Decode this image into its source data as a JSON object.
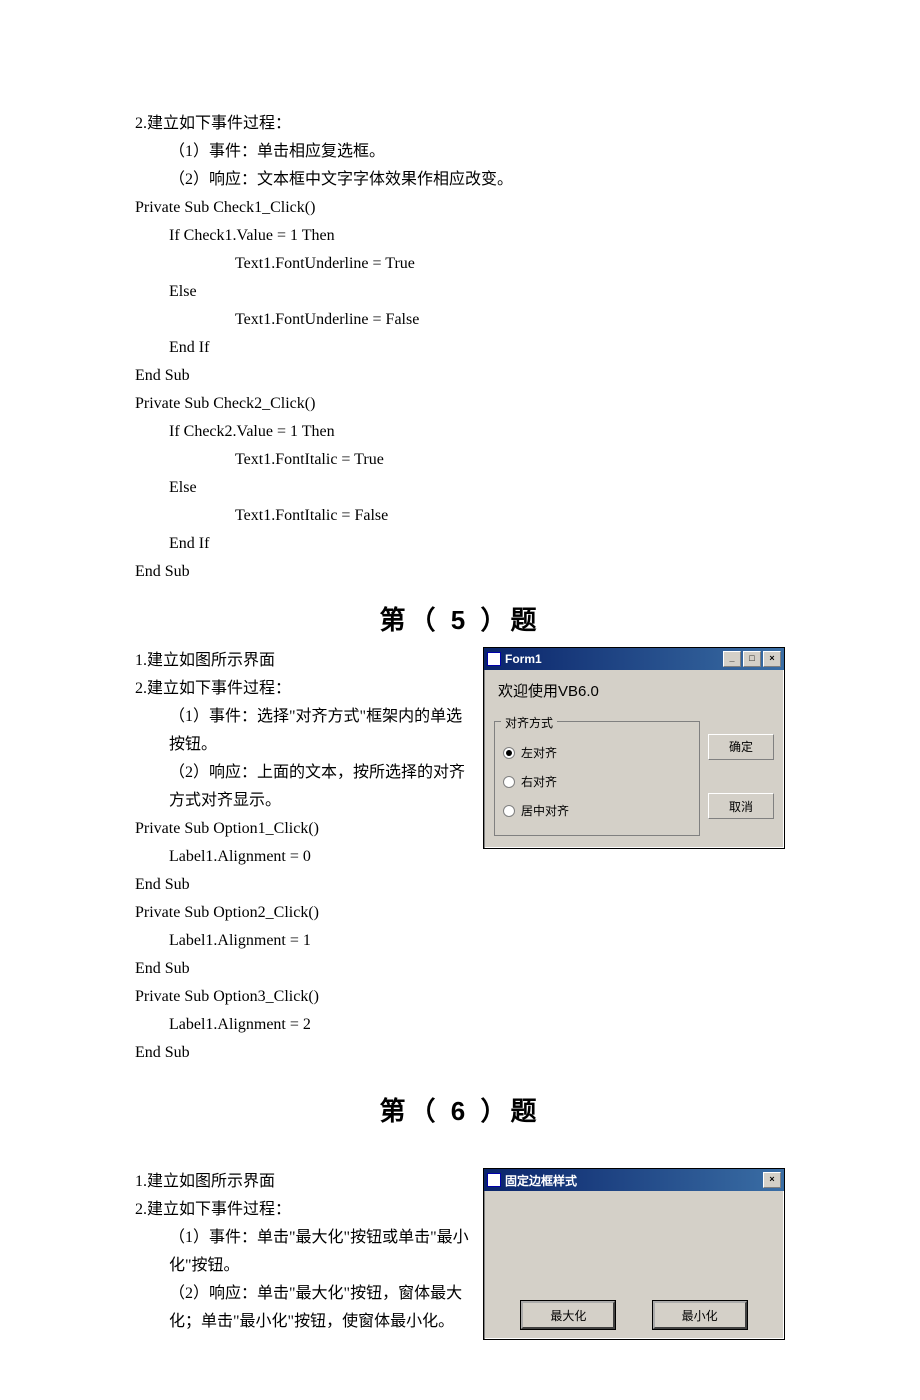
{
  "q4_tail": {
    "line1": "2.建立如下事件过程：",
    "line2": "（1）事件：单击相应复选框。",
    "line3": "（2）响应：文本框中文字字体效果作相应改变。",
    "code": [
      "Private Sub Check1_Click()",
      "    If Check1.Value = 1 Then",
      "            Text1.FontUnderline = True",
      "    Else",
      "            Text1.FontUnderline = False",
      "    End If",
      "End Sub",
      "Private Sub Check2_Click()",
      "    If Check2.Value = 1 Then",
      "            Text1.FontItalic = True",
      "    Else",
      "            Text1.FontItalic = False",
      "    End If",
      "End Sub"
    ]
  },
  "q5": {
    "heading": "第（ 5 ）题",
    "lines": [
      "1.建立如图所示界面",
      "2.建立如下事件过程：",
      "（1）事件：选择\"对齐方式\"框架内的单选按钮。",
      "（2）响应：上面的文本，按所选择的对齐方式对齐显示。"
    ],
    "code": [
      "Private Sub Option1_Click()",
      "    Label1.Alignment = 0",
      "End Sub",
      "Private Sub Option2_Click()",
      "    Label1.Alignment = 1",
      "End Sub",
      "Private Sub Option3_Click()",
      "    Label1.Alignment = 2",
      "End Sub"
    ],
    "window": {
      "title": "Form1",
      "label": "欢迎使用VB6.0",
      "frame_caption": "对齐方式",
      "options": [
        "左对齐",
        "右对齐",
        "居中对齐"
      ],
      "selected_index": 0,
      "ok_btn": "确定",
      "cancel_btn": "取消"
    }
  },
  "q6": {
    "heading": "第（ 6 ）题",
    "lines": [
      "1.建立如图所示界面",
      "2.建立如下事件过程：",
      "（1）事件：单击\"最大化\"按钮或单击\"最小化\"按钮。",
      "（2）响应：单击\"最大化\"按钮，窗体最大化；单击\"最小化\"按钮，使窗体最小化。"
    ],
    "window": {
      "title": "固定边框样式",
      "max_btn": "最大化",
      "min_btn": "最小化"
    }
  }
}
